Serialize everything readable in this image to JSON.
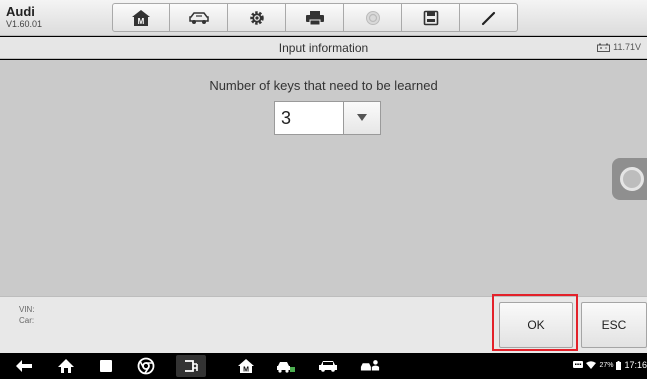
{
  "app": {
    "make": "Audi",
    "version": "V1.60.01"
  },
  "toolbar": {
    "buttons": [
      {
        "icon": "home-icon"
      },
      {
        "icon": "vehicle-swap-icon"
      },
      {
        "icon": "settings-gear-icon"
      },
      {
        "icon": "printer-icon"
      },
      {
        "icon": "help-icon"
      },
      {
        "icon": "save-icon"
      },
      {
        "icon": "pen-icon"
      }
    ]
  },
  "titlebar": {
    "title": "Input information",
    "battery_voltage": "11.71V"
  },
  "form": {
    "prompt": "Number of keys that need to be learned",
    "selected_value": "3"
  },
  "vehicle_info": {
    "vin_label": "VIN:",
    "car_label": "Car:"
  },
  "actions": {
    "ok_label": "OK",
    "esc_label": "ESC"
  },
  "status_bar": {
    "battery_percent": "27%",
    "time": "17:16"
  },
  "colors": {
    "highlight": "#e3212a",
    "content_bg": "#cacaca"
  }
}
